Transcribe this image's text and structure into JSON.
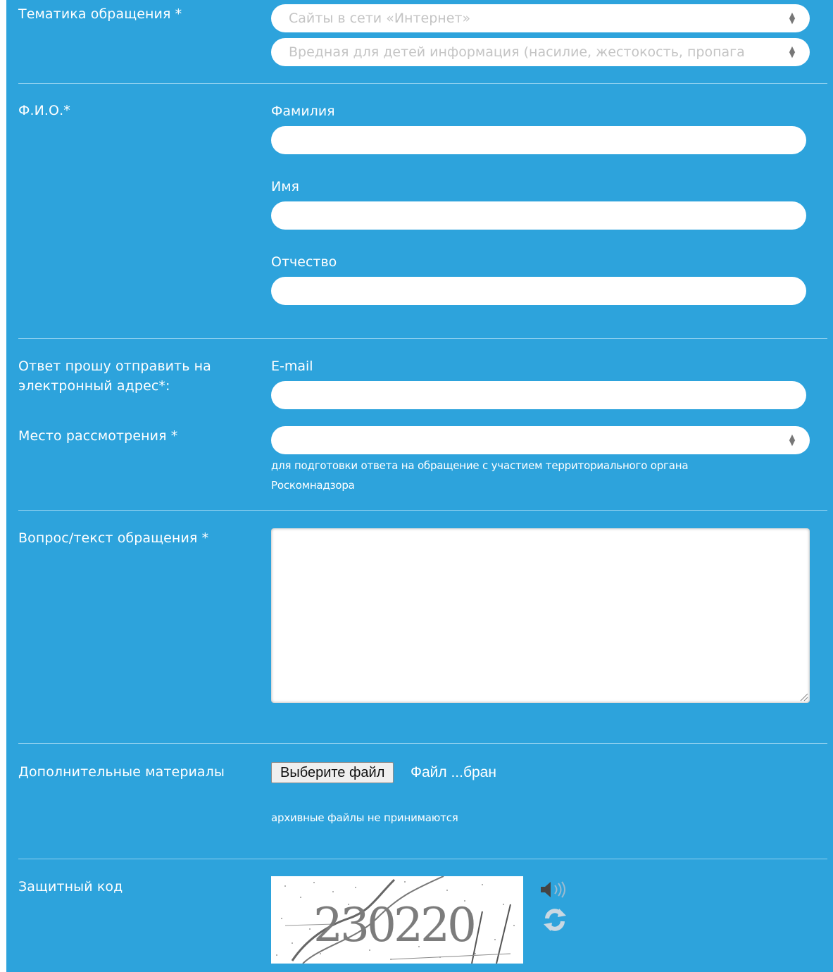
{
  "topic": {
    "label": "Тематика обращения *",
    "select1_value": "Сайты в сети «Интернет»",
    "select2_value": "Вредная для детей информация (насилие, жестокость, пропага"
  },
  "fio": {
    "label": "Ф.И.О.*",
    "surname_label": "Фамилия",
    "name_label": "Имя",
    "patronymic_label": "Отчество"
  },
  "reply": {
    "label_line1": "Ответ прошу отправить на",
    "label_line2": "электронный адрес*:",
    "email_label": "E-mail"
  },
  "place": {
    "label": "Место рассмотрения *",
    "hint_line1": "для подготовки ответа на обращение с участием территориального органа",
    "hint_line2": "Роскомнадзора"
  },
  "question": {
    "label": "Вопрос/текст обращения *"
  },
  "attachments": {
    "label": "Дополнительные материалы",
    "button_label": "Выберите файл",
    "file_status": "Файл ...бран",
    "hint": "архивные файлы не принимаются"
  },
  "captcha": {
    "label": "Защитный код",
    "code_text": "230220",
    "audio_icon": "speaker-icon",
    "refresh_icon": "refresh-icon"
  },
  "colors": {
    "panel": "#2da3dc",
    "divider": "#8fd0ef",
    "field": "#ffffff"
  }
}
